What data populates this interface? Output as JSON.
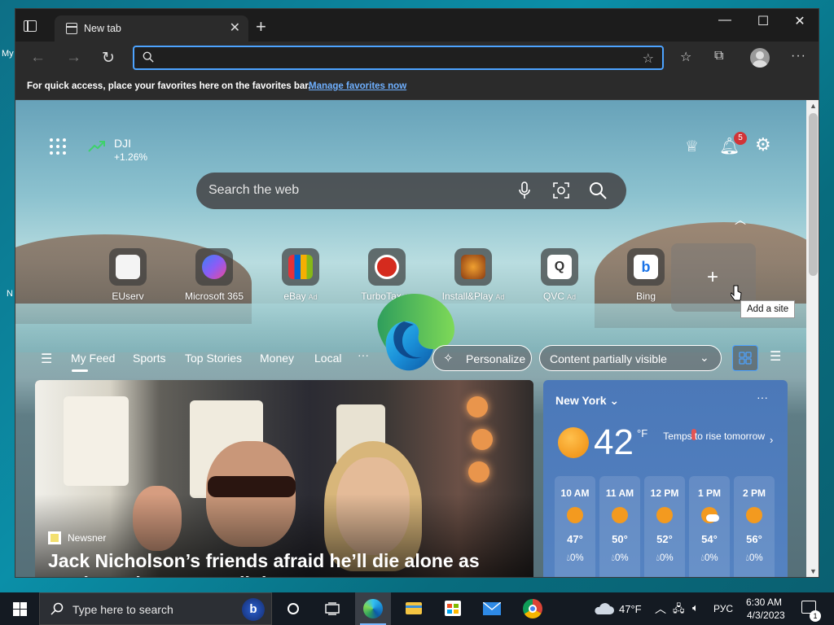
{
  "desktop": {
    "icon_label_1": "My",
    "icon_label_2": "N"
  },
  "browser": {
    "tab_title": "New tab",
    "window_controls": [
      "minimize",
      "maximize",
      "close"
    ],
    "address_bar": {
      "value": "",
      "placeholder": ""
    },
    "favorites_bar": {
      "message": "For quick access, place your favorites here on the favorites bar.",
      "link": "Manage favorites now"
    },
    "icons": [
      "tab-actions-icon",
      "back-arrow-icon",
      "forward-arrow-icon",
      "refresh-icon",
      "add-favorite-icon",
      "favorites-icon",
      "collections-icon",
      "profile-icon",
      "more-icon"
    ]
  },
  "newtab": {
    "ticker": {
      "name": "DJI",
      "change": "+1.26%",
      "color": "#3fd16b"
    },
    "notification_count": "5",
    "search": {
      "placeholder": "Search the web"
    },
    "quick_links": [
      {
        "label": "EUserv",
        "ad": "",
        "color": "#f4f4f4"
      },
      {
        "label": "Microsoft 365",
        "ad": "",
        "color": "#7b5cf0"
      },
      {
        "label": "eBay",
        "ad": "Ad",
        "color": "#2d2d2d"
      },
      {
        "label": "TurboTax",
        "ad": "Ad",
        "color": "#d52b1e"
      },
      {
        "label": "Install&Play",
        "ad": "Ad",
        "color": "#8a3b12"
      },
      {
        "label": "QVC",
        "ad": "Ad",
        "color": "#ffffff"
      },
      {
        "label": "Bing",
        "ad": "",
        "color": "#ffffff"
      }
    ],
    "add_site_tooltip": "Add a site",
    "feed_tabs": [
      "My Feed",
      "Sports",
      "Top Stories",
      "Money",
      "Local"
    ],
    "feed_more": "···",
    "personalize": "Personalize",
    "content_visibility": "Content partially visible",
    "hero": {
      "source": "Newsner",
      "title": "Jack Nicholson’s friends afraid he’ll die alone as tragic truth comes to light"
    },
    "weather": {
      "city": "New York",
      "temp": "42",
      "unit": "°F",
      "tomorrow": "Temps to rise tomorrow",
      "hours": [
        {
          "time": "10 AM",
          "temp": "47°",
          "precip": "0%",
          "icon": "sun-icon"
        },
        {
          "time": "11 AM",
          "temp": "50°",
          "precip": "0%",
          "icon": "sun-icon"
        },
        {
          "time": "12 PM",
          "temp": "52°",
          "precip": "0%",
          "icon": "sun-icon"
        },
        {
          "time": "1 PM",
          "temp": "54°",
          "precip": "0%",
          "icon": "partly-cloudy-icon"
        },
        {
          "time": "2 PM",
          "temp": "56°",
          "precip": "0%",
          "icon": "sun-icon"
        }
      ]
    }
  },
  "taskbar": {
    "search_placeholder": "Type here to search",
    "weather": "47°F",
    "language": "РУС",
    "time": "6:30 AM",
    "date": "4/3/2023",
    "notification_count": "1"
  }
}
